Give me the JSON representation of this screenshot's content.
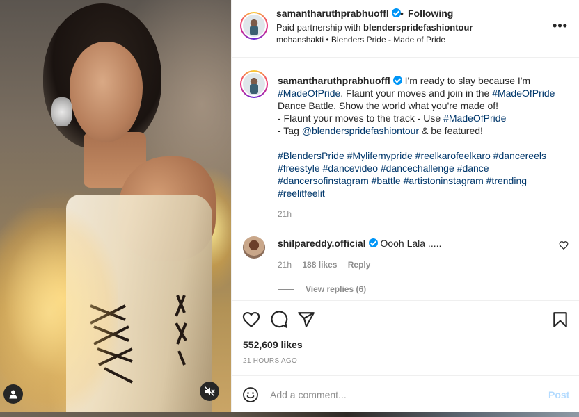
{
  "post": {
    "author": "samantharuthprabhuoffl",
    "following_label": "Following",
    "dot": "•",
    "partner_prefix": "Paid partnership with",
    "partner_name": "blenderspridefashiontour",
    "audio": "mohanshakti • Blenders Pride - Made of Pride",
    "more_label": "•••"
  },
  "caption": {
    "author": "samantharuthprabhuoffl",
    "segments": [
      {
        "t": "I'm ready to slay because I'm "
      },
      {
        "t": "#MadeOfPride",
        "link": true
      },
      {
        "t": ". Flaunt your moves and join in the "
      },
      {
        "t": "#MadeOfPride",
        "link": true
      },
      {
        "t": " Dance Battle. Show the world what you're made of!\n- Flaunt your moves to the track - Use "
      },
      {
        "t": "#MadeOfPride",
        "link": true
      },
      {
        "t": "\n- Tag "
      },
      {
        "t": "@blenderspridefashiontour",
        "link": true
      },
      {
        "t": " & be featured!\n\n"
      },
      {
        "t": "#BlendersPride",
        "link": true
      },
      {
        "t": " "
      },
      {
        "t": "#Mylifemypride",
        "link": true
      },
      {
        "t": " "
      },
      {
        "t": "#reelkarofeelkaro",
        "link": true
      },
      {
        "t": " "
      },
      {
        "t": "#dancereels",
        "link": true
      },
      {
        "t": " "
      },
      {
        "t": "#freestyle",
        "link": true
      },
      {
        "t": " "
      },
      {
        "t": "#dancevideo",
        "link": true
      },
      {
        "t": " "
      },
      {
        "t": "#dancechallenge",
        "link": true
      },
      {
        "t": " "
      },
      {
        "t": "#dance",
        "link": true
      },
      {
        "t": " "
      },
      {
        "t": "#dancersofinstagram",
        "link": true
      },
      {
        "t": " "
      },
      {
        "t": "#battle",
        "link": true
      },
      {
        "t": " "
      },
      {
        "t": "#artistoninstagram",
        "link": true
      },
      {
        "t": " "
      },
      {
        "t": "#trending",
        "link": true
      },
      {
        "t": " "
      },
      {
        "t": "#reelitfeelit",
        "link": true
      }
    ],
    "time": "21h"
  },
  "comment": {
    "author": "shilpareddy.official",
    "text": "Oooh Lala .....",
    "time": "21h",
    "likes": "188 likes",
    "reply_label": "Reply",
    "view_replies": "View replies (6)"
  },
  "actions": {
    "likes_count": "552,609 likes",
    "timestamp": "21 HOURS AGO"
  },
  "add_comment": {
    "placeholder": "Add a comment...",
    "post_label": "Post"
  },
  "colors": {
    "link": "#00376b",
    "verified": "#0095f6",
    "post_disabled": "#b3dbff",
    "muted": "#8e8e8e"
  },
  "icons": {
    "media_user_tag": "user-icon",
    "media_mute": "muted-speaker-icon",
    "like": "heart-icon",
    "comment": "speech-bubble-icon",
    "share": "paper-plane-icon",
    "save": "bookmark-icon",
    "emoji": "smiley-icon",
    "more": "more-options-icon"
  }
}
